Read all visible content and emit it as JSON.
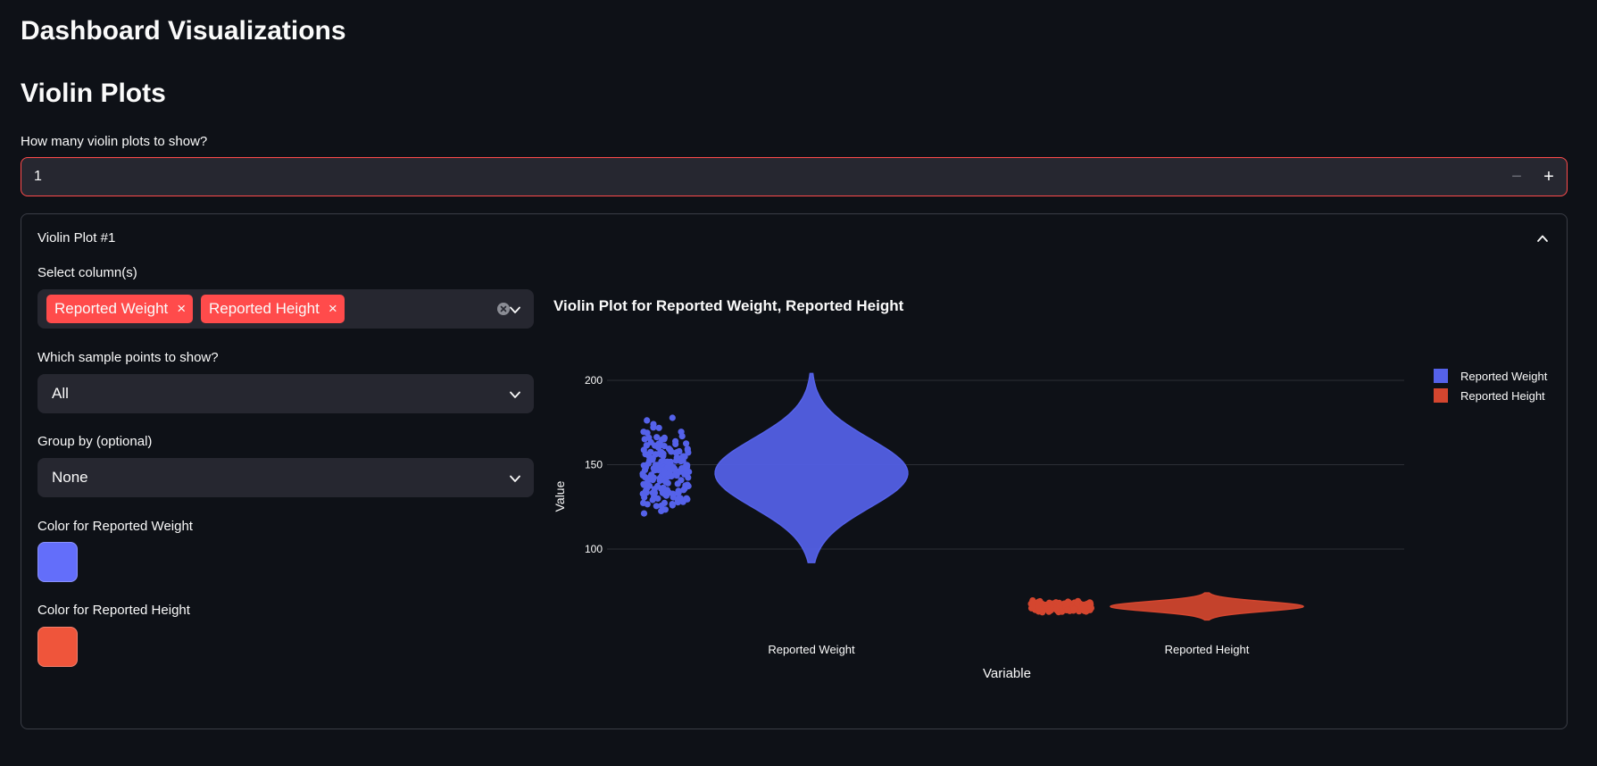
{
  "page": {
    "title": "Dashboard Visualizations",
    "section_title": "Violin Plots"
  },
  "count": {
    "label": "How many violin plots to show?",
    "value": "1",
    "minus": "−",
    "plus": "+"
  },
  "expander": {
    "title": "Violin Plot #1",
    "columns_label": "Select column(s)",
    "columns": [
      "Reported Weight",
      "Reported Height"
    ],
    "tag_remove": "×",
    "points_label": "Which sample points to show?",
    "points_value": "All",
    "group_label": "Group by (optional)",
    "group_value": "None",
    "color1_label": "Color for Reported Weight",
    "color1_value": "#636efa",
    "color2_label": "Color for Reported Height",
    "color2_value": "#ef553b"
  },
  "chart_data": {
    "type": "violin",
    "title": "Violin Plot for Reported Weight, Reported Height",
    "xlabel": "Variable",
    "ylabel": "Value",
    "ylim": [
      80,
      205
    ],
    "yticks": [
      100,
      150,
      200
    ],
    "categories": [
      "Reported Weight",
      "Reported Height"
    ],
    "legend_position": "top-right",
    "series": [
      {
        "name": "Reported Weight",
        "color": "#5562ea",
        "min": 92,
        "max": 204,
        "median": 145,
        "points_range": [
          103,
          193
        ]
      },
      {
        "name": "Reported Height",
        "color": "#d4462f",
        "min": 58,
        "max": 74,
        "median": 66,
        "points_range": [
          60,
          72
        ]
      }
    ]
  }
}
